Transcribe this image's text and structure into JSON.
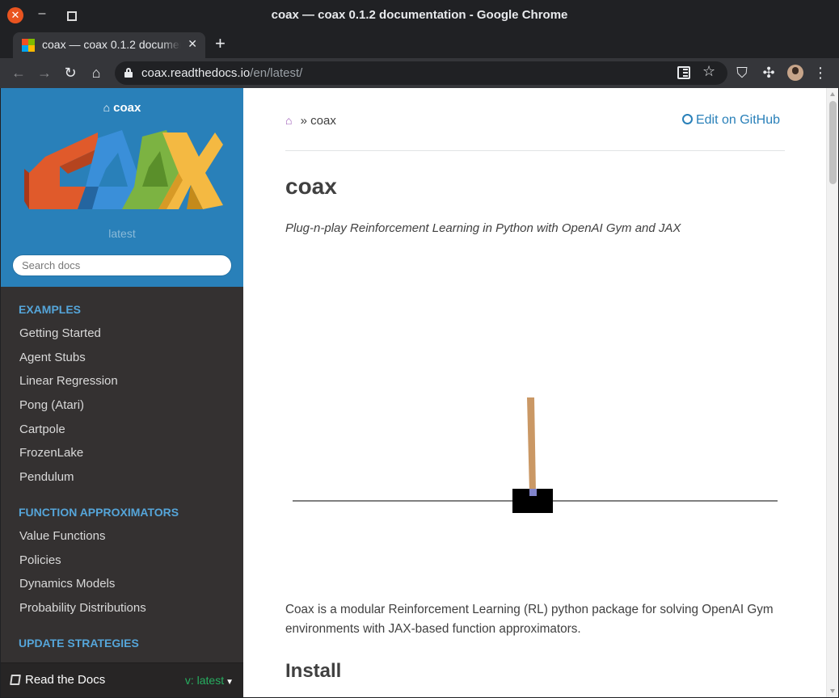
{
  "window": {
    "title": "coax — coax 0.1.2 documentation - Google Chrome"
  },
  "tab": {
    "title": "coax — coax 0.1.2 documentation",
    "close": "✕",
    "new_tab": "+"
  },
  "omnibox": {
    "host": "coax.readthedocs.io",
    "path": "/en/latest/"
  },
  "sidebar": {
    "project": "coax",
    "version": "latest",
    "search_placeholder": "Search docs",
    "sections": [
      {
        "caption": "EXAMPLES",
        "items": [
          "Getting Started",
          "Agent Stubs",
          "Linear Regression",
          "Pong (Atari)",
          "Cartpole",
          "FrozenLake",
          "Pendulum"
        ]
      },
      {
        "caption": "FUNCTION APPROXIMATORS",
        "items": [
          "Value Functions",
          "Policies",
          "Dynamics Models",
          "Probability Distributions"
        ]
      },
      {
        "caption": "UPDATE STRATEGIES",
        "items": []
      }
    ],
    "rtd": {
      "label": "Read the Docs",
      "version": "v: latest"
    }
  },
  "content": {
    "breadcrumb": "coax",
    "breadcrumb_sep": "»",
    "edit_link": "Edit on GitHub",
    "h1": "coax",
    "tagline": "Plug-n-play Reinforcement Learning in Python with OpenAI Gym and JAX",
    "paragraph": "Coax is a modular Reinforcement Learning (RL) python package for solving OpenAI Gym environments with JAX-based function approximators.",
    "h2": "Install"
  },
  "colors": {
    "sidebar_top": "#2980b9",
    "sidebar_bg": "#343131",
    "caption": "#55a5d9",
    "link": "#2980b9",
    "home_crumb": "#9b59b6",
    "rtd_version": "#27ae60"
  }
}
